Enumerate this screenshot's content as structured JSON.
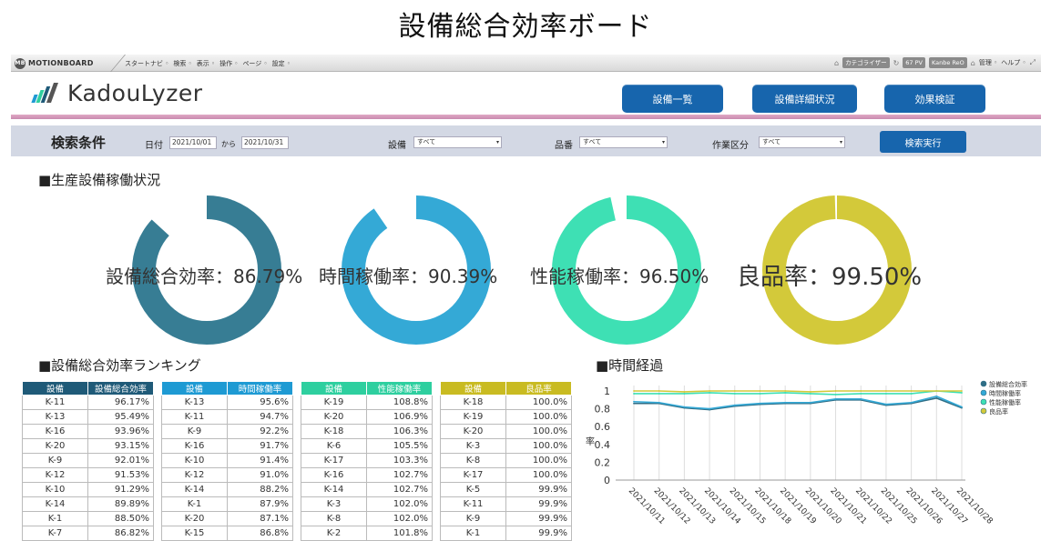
{
  "page_title": "設備総合効率ボード",
  "toolbar": {
    "logo": "MOTIONBOARD",
    "menu": [
      "スタートナビ",
      "検索",
      "表示",
      "操作",
      "ページ",
      "設定"
    ],
    "right_chips": [
      "カテゴライザー",
      "67 PV",
      "Kanbe ReO"
    ],
    "right_links": [
      "管理",
      "ヘルプ"
    ]
  },
  "brand": {
    "name": "KadouLyzer"
  },
  "nav": [
    {
      "label": "設備一覧"
    },
    {
      "label": "設備詳細状況"
    },
    {
      "label": "効果検証"
    }
  ],
  "search": {
    "title": "検索条件",
    "date_label": "日付",
    "date_from": "2021/10/01",
    "date_sep": "から",
    "date_to": "2021/10/31",
    "equipment_label": "設備",
    "equipment_value": "すべて",
    "product_label": "品番",
    "product_value": "すべて",
    "work_label": "作業区分",
    "work_value": "すべて",
    "submit": "検索実行"
  },
  "sections": {
    "status": "■生産設備稼働状況",
    "ranking": "■設備総合効率ランキング",
    "timeline": "■時間経過"
  },
  "colors": {
    "oee": "#377d94",
    "availability": "#34a9d6",
    "performance": "#3ee0b4",
    "quality": "#d3c93a",
    "nav": "#1765ad",
    "search_bg": "#d3d8e4"
  },
  "donuts": [
    {
      "label": "設備総合効率：86.79%",
      "value": 86.79,
      "color": "#377d94"
    },
    {
      "label": "時間稼働率：90.39%",
      "value": 90.39,
      "color": "#34a9d6"
    },
    {
      "label": "性能稼働率：96.50%",
      "value": 96.5,
      "color": "#3ee0b4"
    },
    {
      "label": "良品率：99.50%",
      "value": 99.5,
      "color": "#d3c93a"
    }
  ],
  "tables": [
    {
      "headers": [
        "設備",
        "設備総合効率"
      ],
      "header_color": "#1f5a78",
      "rows": [
        [
          "K-11",
          "96.17%"
        ],
        [
          "K-13",
          "95.49%"
        ],
        [
          "K-16",
          "93.96%"
        ],
        [
          "K-20",
          "93.15%"
        ],
        [
          "K-9",
          "92.01%"
        ],
        [
          "K-12",
          "91.53%"
        ],
        [
          "K-10",
          "91.29%"
        ],
        [
          "K-14",
          "89.89%"
        ],
        [
          "K-1",
          "88.50%"
        ],
        [
          "K-7",
          "86.82%"
        ]
      ]
    },
    {
      "headers": [
        "設備",
        "時間稼働率"
      ],
      "header_color": "#1e9ad3",
      "rows": [
        [
          "K-13",
          "95.6%"
        ],
        [
          "K-11",
          "94.7%"
        ],
        [
          "K-9",
          "92.2%"
        ],
        [
          "K-16",
          "91.7%"
        ],
        [
          "K-10",
          "91.4%"
        ],
        [
          "K-12",
          "91.0%"
        ],
        [
          "K-14",
          "88.2%"
        ],
        [
          "K-1",
          "87.9%"
        ],
        [
          "K-20",
          "87.1%"
        ],
        [
          "K-15",
          "86.8%"
        ]
      ]
    },
    {
      "headers": [
        "設備",
        "性能稼働率"
      ],
      "header_color": "#2ecf9f",
      "rows": [
        [
          "K-19",
          "108.8%"
        ],
        [
          "K-20",
          "106.9%"
        ],
        [
          "K-18",
          "106.3%"
        ],
        [
          "K-6",
          "105.5%"
        ],
        [
          "K-17",
          "103.3%"
        ],
        [
          "K-16",
          "102.7%"
        ],
        [
          "K-14",
          "102.7%"
        ],
        [
          "K-3",
          "102.0%"
        ],
        [
          "K-8",
          "102.0%"
        ],
        [
          "K-2",
          "101.8%"
        ]
      ]
    },
    {
      "headers": [
        "設備",
        "良品率"
      ],
      "header_color": "#c9bb22",
      "rows": [
        [
          "K-18",
          "100.0%"
        ],
        [
          "K-19",
          "100.0%"
        ],
        [
          "K-20",
          "100.0%"
        ],
        [
          "K-3",
          "100.0%"
        ],
        [
          "K-8",
          "100.0%"
        ],
        [
          "K-17",
          "100.0%"
        ],
        [
          "K-5",
          "99.9%"
        ],
        [
          "K-11",
          "99.9%"
        ],
        [
          "K-9",
          "99.9%"
        ],
        [
          "K-1",
          "99.9%"
        ]
      ]
    }
  ],
  "chart_data": {
    "type": "line",
    "title": "",
    "xlabel": "",
    "ylabel": "率",
    "ylim": [
      0,
      1
    ],
    "yticks": [
      0,
      0.2,
      0.4,
      0.6,
      0.8,
      1
    ],
    "ytick_labels": [
      "0",
      "0.2",
      "0.4",
      "0.6",
      "0.8",
      "1"
    ],
    "grid": "vertical",
    "legend": "top-right",
    "x": [
      "2021/10/11",
      "2021/10/12",
      "2021/10/13",
      "2021/10/14",
      "2021/10/15",
      "2021/10/18",
      "2021/10/19",
      "2021/10/20",
      "2021/10/21",
      "2021/10/22",
      "2021/10/25",
      "2021/10/26",
      "2021/10/27",
      "2021/10/28"
    ],
    "series": [
      {
        "name": "設備総合効率",
        "color": "#2f6e86",
        "values": [
          0.86,
          0.86,
          0.81,
          0.79,
          0.83,
          0.85,
          0.86,
          0.86,
          0.9,
          0.9,
          0.84,
          0.86,
          0.92,
          0.81
        ]
      },
      {
        "name": "時間稼働率",
        "color": "#34a9d6",
        "values": [
          0.88,
          0.87,
          0.82,
          0.8,
          0.84,
          0.86,
          0.87,
          0.87,
          0.91,
          0.91,
          0.85,
          0.87,
          0.94,
          0.82
        ]
      },
      {
        "name": "性能稼働率",
        "color": "#3ee0b4",
        "values": [
          0.97,
          0.97,
          0.97,
          0.98,
          0.97,
          0.97,
          0.98,
          0.97,
          0.96,
          0.97,
          0.97,
          0.97,
          1.0,
          0.98
        ]
      },
      {
        "name": "良品率",
        "color": "#d3c93a",
        "values": [
          1.0,
          1.0,
          0.99,
          1.0,
          1.0,
          1.0,
          1.0,
          0.99,
          1.0,
          1.0,
          1.0,
          1.0,
          1.0,
          1.0
        ]
      }
    ]
  }
}
